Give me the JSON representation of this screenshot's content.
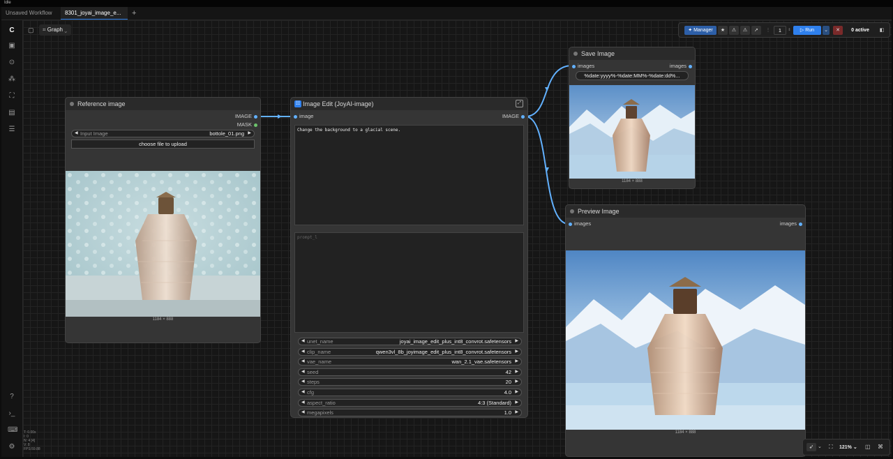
{
  "window": {
    "title": "Idle"
  },
  "tabs": [
    {
      "label": "Unsaved Workflow",
      "active": false
    },
    {
      "label": "8301_joyai_image_e...",
      "active": true
    }
  ],
  "tab_add": "+",
  "graph_button": "Graph",
  "toolbar": {
    "manager_label": "Manager",
    "run_count": "1",
    "run_label": "Run",
    "active_label": "0 active"
  },
  "nodes": {
    "reference": {
      "title": "Reference image",
      "out_image": "IMAGE",
      "out_mask": "MASK",
      "input_label": "Input Image",
      "input_value": "bottole_01.png",
      "upload_label": "choose file to upload",
      "image_size": "1184 × 888"
    },
    "edit": {
      "title": "Image Edit (JoyAI-image)",
      "in_image": "image",
      "out_image": "IMAGE",
      "prompt": "Change the background to a glacial scene.",
      "negative_placeholder": "prompt_l",
      "widgets": [
        {
          "label": "unet_name",
          "value": "joyai_image_edit_plus_int8_convrot.safetensors"
        },
        {
          "label": "clip_name",
          "value": "qwen3vl_8b_joyimage_edit_plus_int8_convrot.safetensors"
        },
        {
          "label": "vae_name",
          "value": "wan_2.1_vae.safetensors"
        },
        {
          "label": "seed",
          "value": "42"
        },
        {
          "label": "steps",
          "value": "20"
        },
        {
          "label": "cfg",
          "value": "4.0"
        },
        {
          "label": "aspect_ratio",
          "value": "4:3 (Standard)"
        },
        {
          "label": "megapixels",
          "value": "1.0"
        }
      ]
    },
    "save": {
      "title": "Save Image",
      "in_images": "images",
      "out_images": "images",
      "filename_prefix": "%date:yyyy%-%date:MM%-%date:dd%...",
      "image_size": "1184 × 888"
    },
    "preview": {
      "title": "Preview Image",
      "in_images": "images",
      "out_images": "images",
      "image_size": "1184 × 888"
    }
  },
  "zoom": "121%",
  "stats": [
    "T: 0.00s",
    "I: 0",
    "N: 4 [4]",
    "V: 8",
    "FPS:59.88"
  ],
  "colors": {
    "accent": "#2f80ed",
    "link": "#62b1ff",
    "mask": "#6cc36c"
  }
}
